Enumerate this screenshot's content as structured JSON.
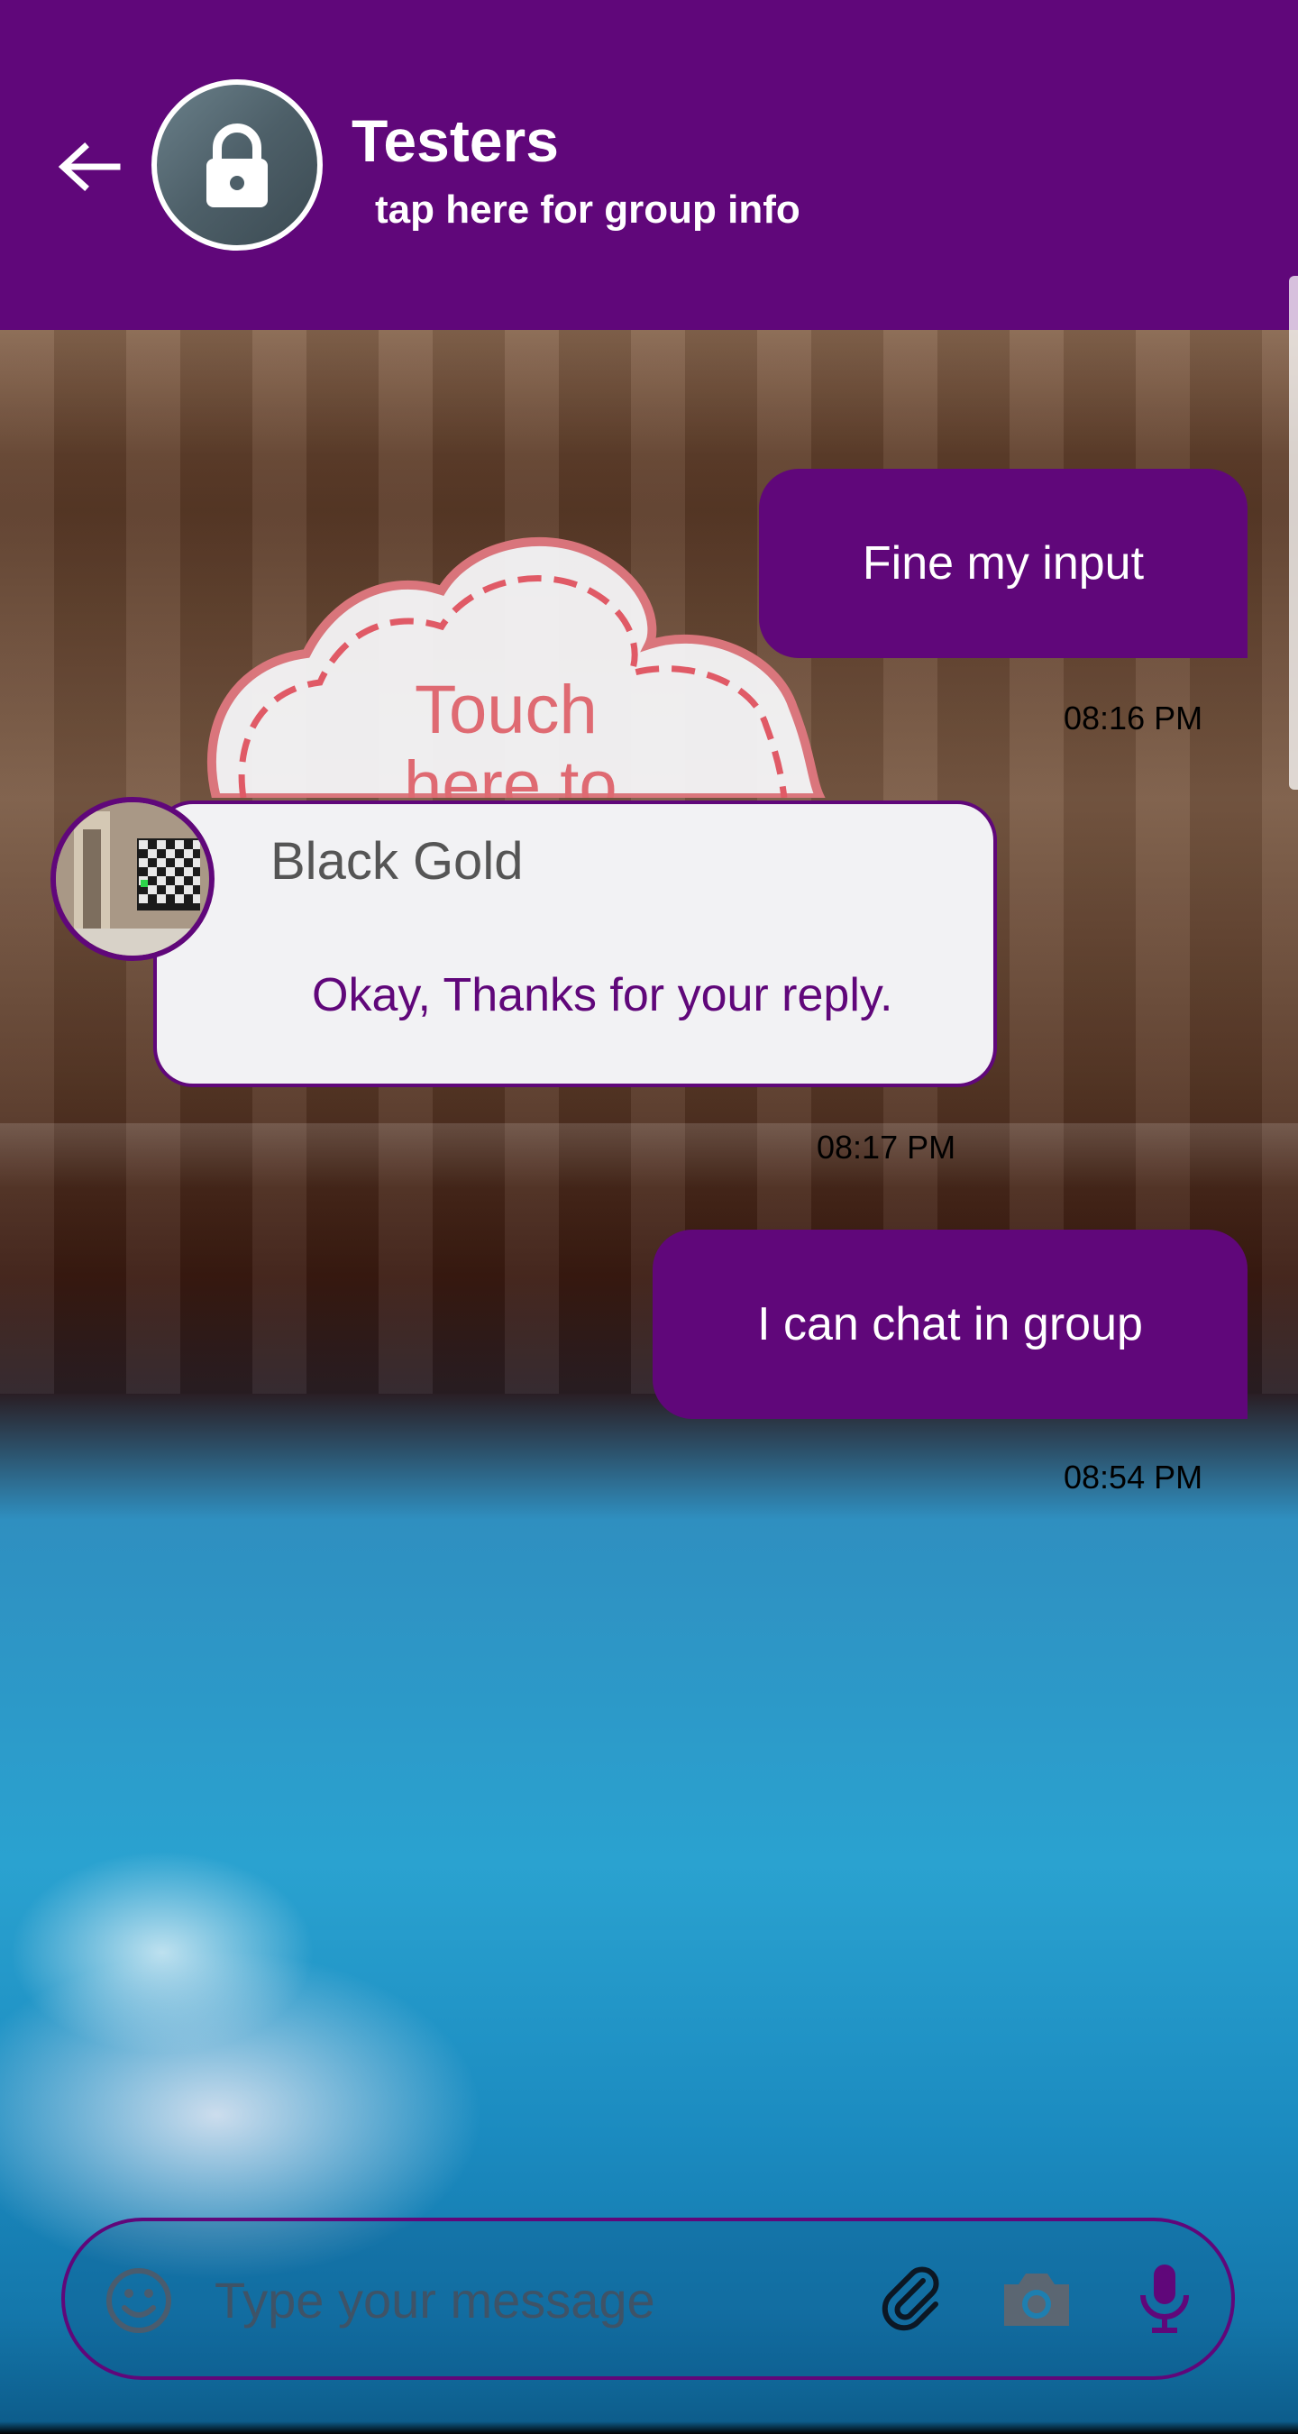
{
  "header": {
    "title": "Testers",
    "subtitle": "tap here for group info",
    "back_icon": "arrow-left-icon",
    "avatar_icon": "lock-icon",
    "background_color": "#60077a"
  },
  "sticker": {
    "text_line1": "Touch",
    "text_line2": "here to"
  },
  "messages": [
    {
      "direction": "outgoing",
      "text": "Fine my input",
      "time": "08:16 PM"
    },
    {
      "direction": "incoming",
      "sender": "Black Gold",
      "text": "Okay, Thanks for your reply.",
      "time": "08:17 PM"
    },
    {
      "direction": "outgoing",
      "text": "I can chat in group",
      "time": "08:54 PM"
    }
  ],
  "input": {
    "placeholder": "Type your message",
    "value": "",
    "icons": [
      "emoji-icon",
      "paperclip-icon",
      "camera-icon",
      "microphone-icon"
    ]
  },
  "colors": {
    "accent": "#60077a",
    "outgoing_bubble": "#60077a",
    "incoming_bubble": "#f2f2f4",
    "incoming_text": "#60077a"
  }
}
